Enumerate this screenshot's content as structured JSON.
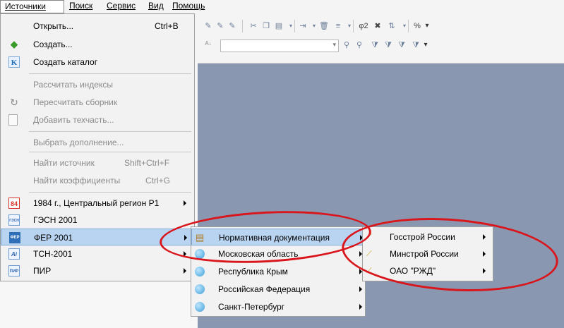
{
  "menubar": {
    "items": [
      "Источники",
      "Поиск",
      "Сервис",
      "Вид",
      "Помощь"
    ]
  },
  "toolbar": {
    "formula_label": "φ2",
    "percent_label": "%",
    "combo_value": ""
  },
  "sources_menu": {
    "items": [
      {
        "label": "Открыть...",
        "shortcut": "Ctrl+B"
      },
      {
        "label": "Создать...",
        "icon": "create-icon"
      },
      {
        "label": "Создать каталог",
        "icon": "catalog-icon",
        "icon_text": "K"
      },
      {
        "label": "Рассчитать индексы"
      },
      {
        "label": "Пересчитать сборник",
        "icon": "refresh-icon"
      },
      {
        "label": "Добавить техчасть...",
        "icon": "document-icon"
      },
      {
        "label": "Выбрать дополнение..."
      },
      {
        "label": "Найти источник",
        "shortcut": "Shift+Ctrl+F"
      },
      {
        "label": "Найти коэффициенты",
        "shortcut": "Ctrl+G"
      },
      {
        "label": "1984 г., Центральный регион Р1",
        "icon_text": "84"
      },
      {
        "label": "ГЭСН 2001",
        "icon_text": "ГЭСН"
      },
      {
        "label": "ФЕР 2001",
        "icon_text": "ФЕР"
      },
      {
        "label": "ТСН-2001",
        "icon_text": "Ai"
      },
      {
        "label": "ПИР",
        "icon_text": "ПИР"
      }
    ]
  },
  "fer_submenu": {
    "items": [
      {
        "label": "Нормативная документация",
        "icon": "folder-icon"
      },
      {
        "label": "Московская область",
        "icon": "globe-icon"
      },
      {
        "label": "Республика Крым",
        "icon": "globe-icon"
      },
      {
        "label": "Российская Федерация",
        "icon": "globe-icon"
      },
      {
        "label": "Санкт-Петербург",
        "icon": "globe-icon"
      }
    ]
  },
  "normdoc_submenu": {
    "items": [
      {
        "label": "Госстрой России"
      },
      {
        "label": "Минстрой России"
      },
      {
        "label": "ОАО \"РЖД\""
      }
    ]
  },
  "colors": {
    "workspace": "#8a97b1",
    "highlight": "#b9d4f0",
    "annotation": "#d9161c"
  }
}
